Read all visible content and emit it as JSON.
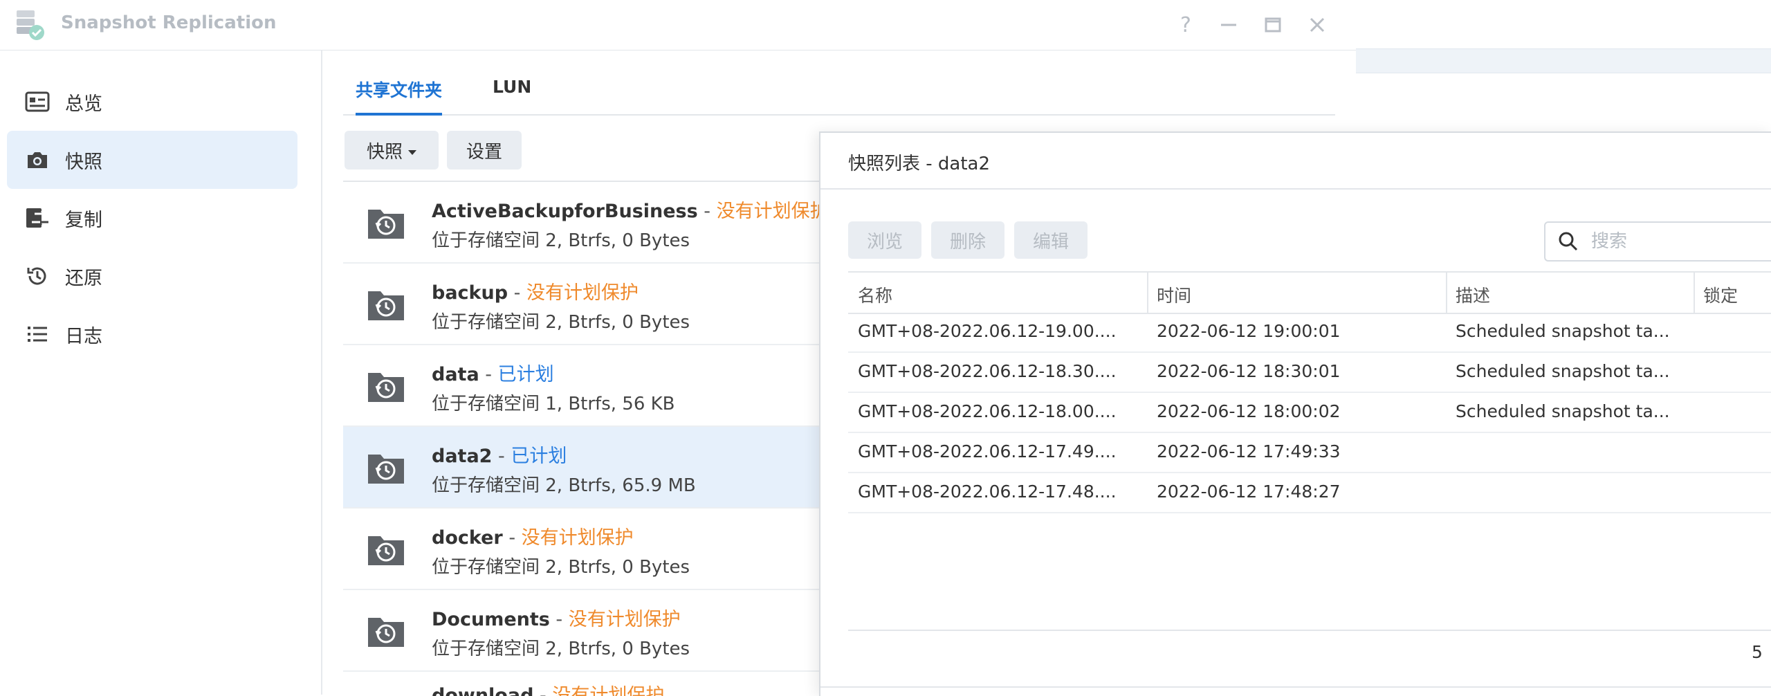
{
  "app": {
    "title": "Snapshot Replication"
  },
  "sidebar": {
    "items": [
      {
        "label": "总览",
        "icon": "overview-icon"
      },
      {
        "label": "快照",
        "icon": "camera-icon",
        "active": true
      },
      {
        "label": "复制",
        "icon": "replication-icon"
      },
      {
        "label": "还原",
        "icon": "restore-icon"
      },
      {
        "label": "日志",
        "icon": "log-list-icon"
      }
    ]
  },
  "tabs": [
    {
      "label": "共享文件夹",
      "active": true
    },
    {
      "label": "LUN"
    }
  ],
  "toolbar": {
    "snapshot_label": "快照",
    "settings_label": "设置"
  },
  "shares": [
    {
      "name": "ActiveBackupforBusiness",
      "sep": " - ",
      "status": "没有计划保护",
      "status_type": "warning",
      "location": "位于存储空间 2, Btrfs, 0 Bytes"
    },
    {
      "name": "backup",
      "sep": " - ",
      "status": "没有计划保护",
      "status_type": "warning",
      "location": "位于存储空间 2, Btrfs, 0 Bytes"
    },
    {
      "name": "data",
      "sep": " - ",
      "status": "已计划",
      "status_type": "scheduled",
      "location": "位于存储空间 1, Btrfs, 56 KB"
    },
    {
      "name": "data2",
      "sep": " - ",
      "status": "已计划",
      "status_type": "scheduled",
      "location": "位于存储空间 2, Btrfs, 65.9 MB",
      "selected": true
    },
    {
      "name": "docker",
      "sep": " - ",
      "status": "没有计划保护",
      "status_type": "warning",
      "location": "位于存储空间 2, Btrfs, 0 Bytes"
    },
    {
      "name": "Documents",
      "sep": " - ",
      "status": "没有计划保护",
      "status_type": "warning",
      "location": "位于存储空间 2, Btrfs, 0 Bytes"
    },
    {
      "name": "download",
      "sep": " - ",
      "status": "没有计划保护",
      "status_type": "warning",
      "location": ""
    }
  ],
  "dialog": {
    "title": "快照列表 - data2",
    "buttons": {
      "browse": "浏览",
      "delete": "删除",
      "edit": "编辑"
    },
    "search_placeholder": "搜索",
    "columns": {
      "name": "名称",
      "time": "时间",
      "description": "描述",
      "lock": "锁定"
    },
    "rows": [
      {
        "name": "GMT+08-2022.06.12-19.00....",
        "time": "2022-06-12 19:00:01",
        "description": "Scheduled snapshot ta..."
      },
      {
        "name": "GMT+08-2022.06.12-18.30....",
        "time": "2022-06-12 18:30:01",
        "description": "Scheduled snapshot ta..."
      },
      {
        "name": "GMT+08-2022.06.12-18.00....",
        "time": "2022-06-12 18:00:02",
        "description": "Scheduled snapshot ta..."
      },
      {
        "name": "GMT+08-2022.06.12-17.49....",
        "time": "2022-06-12 17:49:33",
        "description": ""
      },
      {
        "name": "GMT+08-2022.06.12-17.48....",
        "time": "2022-06-12 17:48:27",
        "description": ""
      }
    ],
    "row_count": "5"
  },
  "colors": {
    "accent": "#1f74d3",
    "warning": "#ef8a2c",
    "scheduled": "#2b7fe0",
    "selected_bg": "#e6f0fb"
  }
}
